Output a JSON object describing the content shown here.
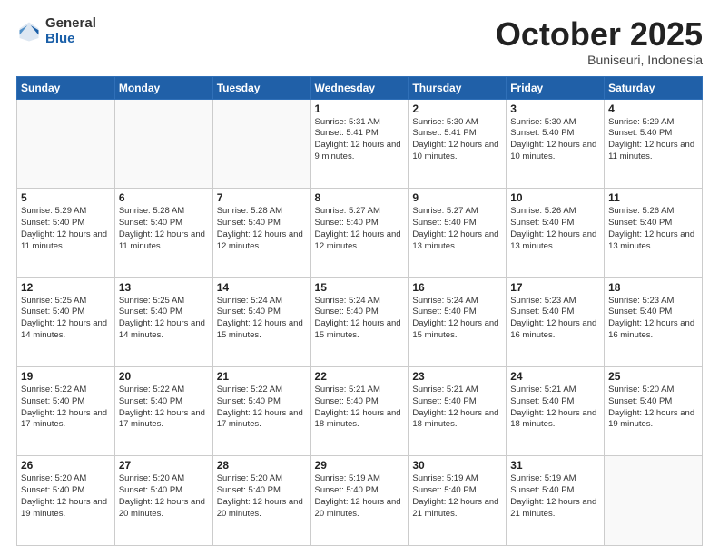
{
  "header": {
    "logo_general": "General",
    "logo_blue": "Blue",
    "month": "October 2025",
    "location": "Buniseuri, Indonesia"
  },
  "weekdays": [
    "Sunday",
    "Monday",
    "Tuesday",
    "Wednesday",
    "Thursday",
    "Friday",
    "Saturday"
  ],
  "weeks": [
    [
      {
        "day": "",
        "info": ""
      },
      {
        "day": "",
        "info": ""
      },
      {
        "day": "",
        "info": ""
      },
      {
        "day": "1",
        "info": "Sunrise: 5:31 AM\nSunset: 5:41 PM\nDaylight: 12 hours and 9 minutes."
      },
      {
        "day": "2",
        "info": "Sunrise: 5:30 AM\nSunset: 5:41 PM\nDaylight: 12 hours and 10 minutes."
      },
      {
        "day": "3",
        "info": "Sunrise: 5:30 AM\nSunset: 5:40 PM\nDaylight: 12 hours and 10 minutes."
      },
      {
        "day": "4",
        "info": "Sunrise: 5:29 AM\nSunset: 5:40 PM\nDaylight: 12 hours and 11 minutes."
      }
    ],
    [
      {
        "day": "5",
        "info": "Sunrise: 5:29 AM\nSunset: 5:40 PM\nDaylight: 12 hours and 11 minutes."
      },
      {
        "day": "6",
        "info": "Sunrise: 5:28 AM\nSunset: 5:40 PM\nDaylight: 12 hours and 11 minutes."
      },
      {
        "day": "7",
        "info": "Sunrise: 5:28 AM\nSunset: 5:40 PM\nDaylight: 12 hours and 12 minutes."
      },
      {
        "day": "8",
        "info": "Sunrise: 5:27 AM\nSunset: 5:40 PM\nDaylight: 12 hours and 12 minutes."
      },
      {
        "day": "9",
        "info": "Sunrise: 5:27 AM\nSunset: 5:40 PM\nDaylight: 12 hours and 13 minutes."
      },
      {
        "day": "10",
        "info": "Sunrise: 5:26 AM\nSunset: 5:40 PM\nDaylight: 12 hours and 13 minutes."
      },
      {
        "day": "11",
        "info": "Sunrise: 5:26 AM\nSunset: 5:40 PM\nDaylight: 12 hours and 13 minutes."
      }
    ],
    [
      {
        "day": "12",
        "info": "Sunrise: 5:25 AM\nSunset: 5:40 PM\nDaylight: 12 hours and 14 minutes."
      },
      {
        "day": "13",
        "info": "Sunrise: 5:25 AM\nSunset: 5:40 PM\nDaylight: 12 hours and 14 minutes."
      },
      {
        "day": "14",
        "info": "Sunrise: 5:24 AM\nSunset: 5:40 PM\nDaylight: 12 hours and 15 minutes."
      },
      {
        "day": "15",
        "info": "Sunrise: 5:24 AM\nSunset: 5:40 PM\nDaylight: 12 hours and 15 minutes."
      },
      {
        "day": "16",
        "info": "Sunrise: 5:24 AM\nSunset: 5:40 PM\nDaylight: 12 hours and 15 minutes."
      },
      {
        "day": "17",
        "info": "Sunrise: 5:23 AM\nSunset: 5:40 PM\nDaylight: 12 hours and 16 minutes."
      },
      {
        "day": "18",
        "info": "Sunrise: 5:23 AM\nSunset: 5:40 PM\nDaylight: 12 hours and 16 minutes."
      }
    ],
    [
      {
        "day": "19",
        "info": "Sunrise: 5:22 AM\nSunset: 5:40 PM\nDaylight: 12 hours and 17 minutes."
      },
      {
        "day": "20",
        "info": "Sunrise: 5:22 AM\nSunset: 5:40 PM\nDaylight: 12 hours and 17 minutes."
      },
      {
        "day": "21",
        "info": "Sunrise: 5:22 AM\nSunset: 5:40 PM\nDaylight: 12 hours and 17 minutes."
      },
      {
        "day": "22",
        "info": "Sunrise: 5:21 AM\nSunset: 5:40 PM\nDaylight: 12 hours and 18 minutes."
      },
      {
        "day": "23",
        "info": "Sunrise: 5:21 AM\nSunset: 5:40 PM\nDaylight: 12 hours and 18 minutes."
      },
      {
        "day": "24",
        "info": "Sunrise: 5:21 AM\nSunset: 5:40 PM\nDaylight: 12 hours and 18 minutes."
      },
      {
        "day": "25",
        "info": "Sunrise: 5:20 AM\nSunset: 5:40 PM\nDaylight: 12 hours and 19 minutes."
      }
    ],
    [
      {
        "day": "26",
        "info": "Sunrise: 5:20 AM\nSunset: 5:40 PM\nDaylight: 12 hours and 19 minutes."
      },
      {
        "day": "27",
        "info": "Sunrise: 5:20 AM\nSunset: 5:40 PM\nDaylight: 12 hours and 20 minutes."
      },
      {
        "day": "28",
        "info": "Sunrise: 5:20 AM\nSunset: 5:40 PM\nDaylight: 12 hours and 20 minutes."
      },
      {
        "day": "29",
        "info": "Sunrise: 5:19 AM\nSunset: 5:40 PM\nDaylight: 12 hours and 20 minutes."
      },
      {
        "day": "30",
        "info": "Sunrise: 5:19 AM\nSunset: 5:40 PM\nDaylight: 12 hours and 21 minutes."
      },
      {
        "day": "31",
        "info": "Sunrise: 5:19 AM\nSunset: 5:40 PM\nDaylight: 12 hours and 21 minutes."
      },
      {
        "day": "",
        "info": ""
      }
    ]
  ]
}
